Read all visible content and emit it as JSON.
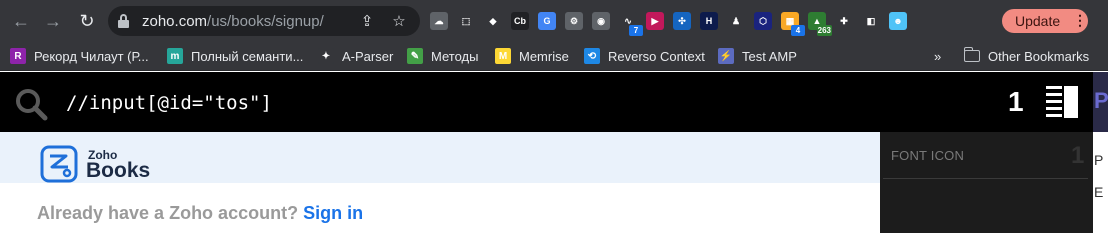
{
  "browser": {
    "url_host": "zoho.com",
    "url_path": "/us/books/signup/",
    "update_label": "Update",
    "extensions": [
      {
        "name": "cloud-extension-icon",
        "color": "#5f6368",
        "glyph": "☁",
        "badge": ""
      },
      {
        "name": "selection-extension-icon",
        "color": "#35363a",
        "glyph": "⬚",
        "badge": ""
      },
      {
        "name": "diamond-extension-icon",
        "color": "#35363a",
        "glyph": "◆",
        "badge": ""
      },
      {
        "name": "cb-extension-icon",
        "color": "#202124",
        "glyph": "Cb",
        "badge": ""
      },
      {
        "name": "google-translate-extension-icon",
        "color": "#4285f4",
        "glyph": "G",
        "badge": ""
      },
      {
        "name": "gear-extension-icon",
        "color": "#5f6368",
        "glyph": "⚙",
        "badge": ""
      },
      {
        "name": "mask-extension-icon",
        "color": "#5f6368",
        "glyph": "◉",
        "badge": ""
      },
      {
        "name": "wave-extension-icon",
        "color": "#35363a",
        "glyph": "∿",
        "badge": "7"
      },
      {
        "name": "play-extension-icon",
        "color": "#c2185b",
        "glyph": "▶",
        "badge": ""
      },
      {
        "name": "dots-extension-icon",
        "color": "#1565c0",
        "glyph": "✣",
        "badge": ""
      },
      {
        "name": "h-extension-icon",
        "color": "#0d1b4c",
        "glyph": "H",
        "badge": ""
      },
      {
        "name": "person-extension-icon",
        "color": "#35363a",
        "glyph": "♟",
        "badge": ""
      },
      {
        "name": "cube-extension-icon",
        "color": "#1a237e",
        "glyph": "⬡",
        "badge": ""
      },
      {
        "name": "folder-extension-icon",
        "color": "#f9a825",
        "glyph": "▦",
        "badge": "4"
      },
      {
        "name": "graph-extension-icon",
        "color": "#2e7d32",
        "glyph": "▲",
        "badge": "263"
      },
      {
        "name": "puzzle-extension-icon",
        "color": "#35363a",
        "glyph": "✚",
        "badge": ""
      },
      {
        "name": "sidebar-extension-icon",
        "color": "#35363a",
        "glyph": "◧",
        "badge": ""
      },
      {
        "name": "profile-avatar-icon",
        "color": "#4fc3f7",
        "glyph": "☻",
        "badge": ""
      }
    ]
  },
  "bookmarks": {
    "items": [
      {
        "label": "Рекорд Чилаут (Р...",
        "icon_color": "#8e24aa",
        "glyph": "R"
      },
      {
        "label": "Полный семанти...",
        "icon_color": "#26a69a",
        "glyph": "m"
      },
      {
        "label": "A-Parser",
        "icon_color": "#35363a",
        "glyph": "✦"
      },
      {
        "label": "Методы",
        "icon_color": "#43a047",
        "glyph": "✎"
      },
      {
        "label": "Memrise",
        "icon_color": "#fdd835",
        "glyph": "M"
      },
      {
        "label": "Reverso Context",
        "icon_color": "#1e88e5",
        "glyph": "⟲"
      },
      {
        "label": "Test AMP",
        "icon_color": "#5c6bc0",
        "glyph": "⚡"
      }
    ],
    "overflow": "»",
    "other_label": "Other Bookmarks"
  },
  "xpath_bar": {
    "query": "//input[@id=\"tos\"]",
    "count": "1"
  },
  "page": {
    "logo_line1": "Zoho",
    "logo_line2": "Books",
    "signin_prompt": "Already have a Zoho account?",
    "signin_link": "Sign in"
  },
  "side_panel": {
    "item_label": "FONT ICON",
    "item_count": "1"
  },
  "colors": {
    "accent_link": "#1a73e8",
    "update_button": "#f28b82",
    "overlay_bg": "#000000"
  }
}
